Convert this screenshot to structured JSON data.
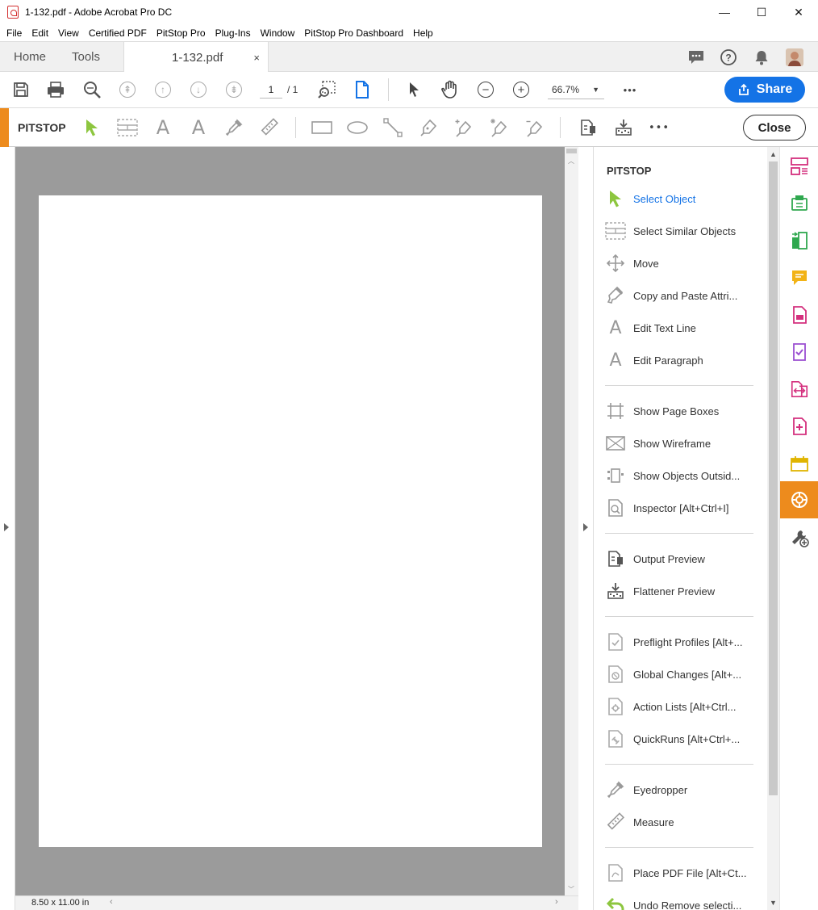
{
  "window": {
    "title": "1-132.pdf - Adobe Acrobat Pro DC",
    "minimize": "—",
    "maximize": "☐",
    "close": "✕"
  },
  "menu": [
    "File",
    "Edit",
    "View",
    "Certified PDF",
    "PitStop Pro",
    "Plug-Ins",
    "Window",
    "PitStop Pro Dashboard",
    "Help"
  ],
  "tabs": {
    "home": "Home",
    "tools": "Tools",
    "document": "1-132.pdf",
    "close_glyph": "×"
  },
  "toolbar": {
    "page_current": "1",
    "page_total": "/ 1",
    "zoom": "66.7%",
    "more": "•••",
    "share_label": "Share"
  },
  "pitstop_bar": {
    "label": "PITSTOP",
    "close_label": "Close",
    "more": "•••"
  },
  "status": {
    "page_size": "8.50 x 11.00 in"
  },
  "panel": {
    "heading": "PITSTOP",
    "items": [
      {
        "label": "Select Object",
        "icon": "select-object-icon"
      },
      {
        "label": "Select Similar Objects",
        "icon": "select-similar-icon"
      },
      {
        "label": "Move",
        "icon": "move-icon"
      },
      {
        "label": "Copy and Paste Attri...",
        "icon": "copy-paste-attributes-icon"
      },
      {
        "label": "Edit Text Line",
        "icon": "edit-text-line-icon"
      },
      {
        "label": "Edit Paragraph",
        "icon": "edit-paragraph-icon"
      },
      {
        "label": "Show Page Boxes",
        "icon": "page-boxes-icon"
      },
      {
        "label": "Show Wireframe",
        "icon": "wireframe-icon"
      },
      {
        "label": "Show Objects Outsid...",
        "icon": "objects-outside-icon"
      },
      {
        "label": "Inspector [Alt+Ctrl+I]",
        "icon": "inspector-icon"
      },
      {
        "label": "Output Preview",
        "icon": "output-preview-icon"
      },
      {
        "label": "Flattener Preview",
        "icon": "flattener-preview-icon"
      },
      {
        "label": "Preflight Profiles [Alt+...",
        "icon": "preflight-profiles-icon"
      },
      {
        "label": "Global Changes [Alt+...",
        "icon": "global-changes-icon"
      },
      {
        "label": "Action Lists [Alt+Ctrl...",
        "icon": "action-lists-icon"
      },
      {
        "label": "QuickRuns [Alt+Ctrl+...",
        "icon": "quickruns-icon"
      },
      {
        "label": "Eyedropper",
        "icon": "eyedropper-icon"
      },
      {
        "label": "Measure",
        "icon": "measure-icon"
      },
      {
        "label": "Place PDF File [Alt+Ct...",
        "icon": "place-pdf-icon"
      },
      {
        "label": "Undo Remove selecti...",
        "icon": "undo-icon"
      }
    ]
  },
  "colors": {
    "accent_blue": "#1473e6",
    "pitstop_orange": "#ed8b1d",
    "select_green": "#8dc63f",
    "doc_gray": "#9b9b9b"
  }
}
